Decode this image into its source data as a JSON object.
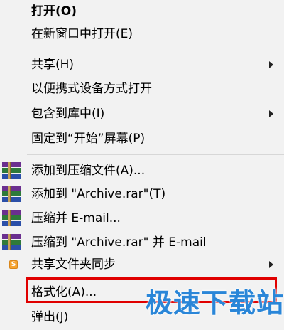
{
  "menu": {
    "open": "打开(O)",
    "open_new_window": "在新窗口中打开(E)",
    "share": "共享(H)",
    "open_portable_device": "以便携式设备方式打开",
    "include_in_library": "包含到库中(I)",
    "pin_to_start": "固定到“开始”屏幕(P)",
    "add_to_archive": "添加到压缩文件(A)...",
    "add_to_archive_rar": "添加到 \"Archive.rar\"(T)",
    "compress_and_email": "压缩并 E-mail...",
    "compress_to_rar_and_email": "压缩到 \"Archive.rar\" 并 E-mail",
    "shared_folder_sync": "共享文件夹同步",
    "format": "格式化(A)...",
    "eject": "弹出(J)"
  },
  "icons": {
    "winrar": "winrar-icon",
    "sync": "shared-folder-sync-icon",
    "sync_glyph": "S"
  },
  "highlight_color": "#e00000",
  "watermark": {
    "text": "极速下载站",
    "color": "#2a86d8"
  }
}
